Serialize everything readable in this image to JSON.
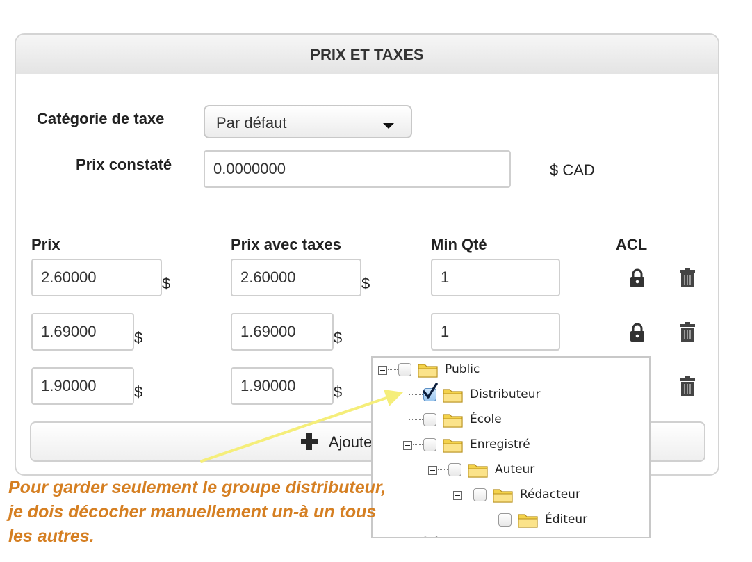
{
  "panel": {
    "title": "PRIX ET TAXES"
  },
  "tax": {
    "label": "Catégorie de taxe",
    "selected": "Par défaut"
  },
  "listprice": {
    "label": "Prix constaté",
    "value": "0.0000000",
    "currency": "$ CAD"
  },
  "columns": {
    "price": "Prix",
    "price_tax": "Prix avec taxes",
    "min_qty": "Min Qté",
    "acl": "ACL"
  },
  "rows": [
    {
      "price": "2.60000",
      "price_tax": "2.60000",
      "min_qty": "1",
      "currency": "$"
    },
    {
      "price": "1.69000",
      "price_tax": "1.69000",
      "min_qty": "1",
      "currency": "$"
    },
    {
      "price": "1.90000",
      "price_tax": "1.90000",
      "currency": "$"
    }
  ],
  "add_button": {
    "label": "Ajoute"
  },
  "tree": {
    "nodes": [
      {
        "label": "Public",
        "checked": false
      },
      {
        "label": "Distributeur",
        "checked": true
      },
      {
        "label": "École",
        "checked": false
      },
      {
        "label": "Enregistré",
        "checked": false
      },
      {
        "label": "Auteur",
        "checked": false
      },
      {
        "label": "Rédacteur",
        "checked": false
      },
      {
        "label": "Éditeur",
        "checked": false
      }
    ]
  },
  "annotation": {
    "lines": [
      "Pour garder seulement le groupe distributeur,",
      "je dois décocher manuellement un-à un tous",
      "les autres."
    ],
    "color": "#d57f22",
    "arrow_color": "#f5ee7a"
  },
  "icons": {
    "lock": "lock-icon",
    "trash": "trash-icon",
    "folder": "folder-icon",
    "plus": "plus-icon"
  }
}
